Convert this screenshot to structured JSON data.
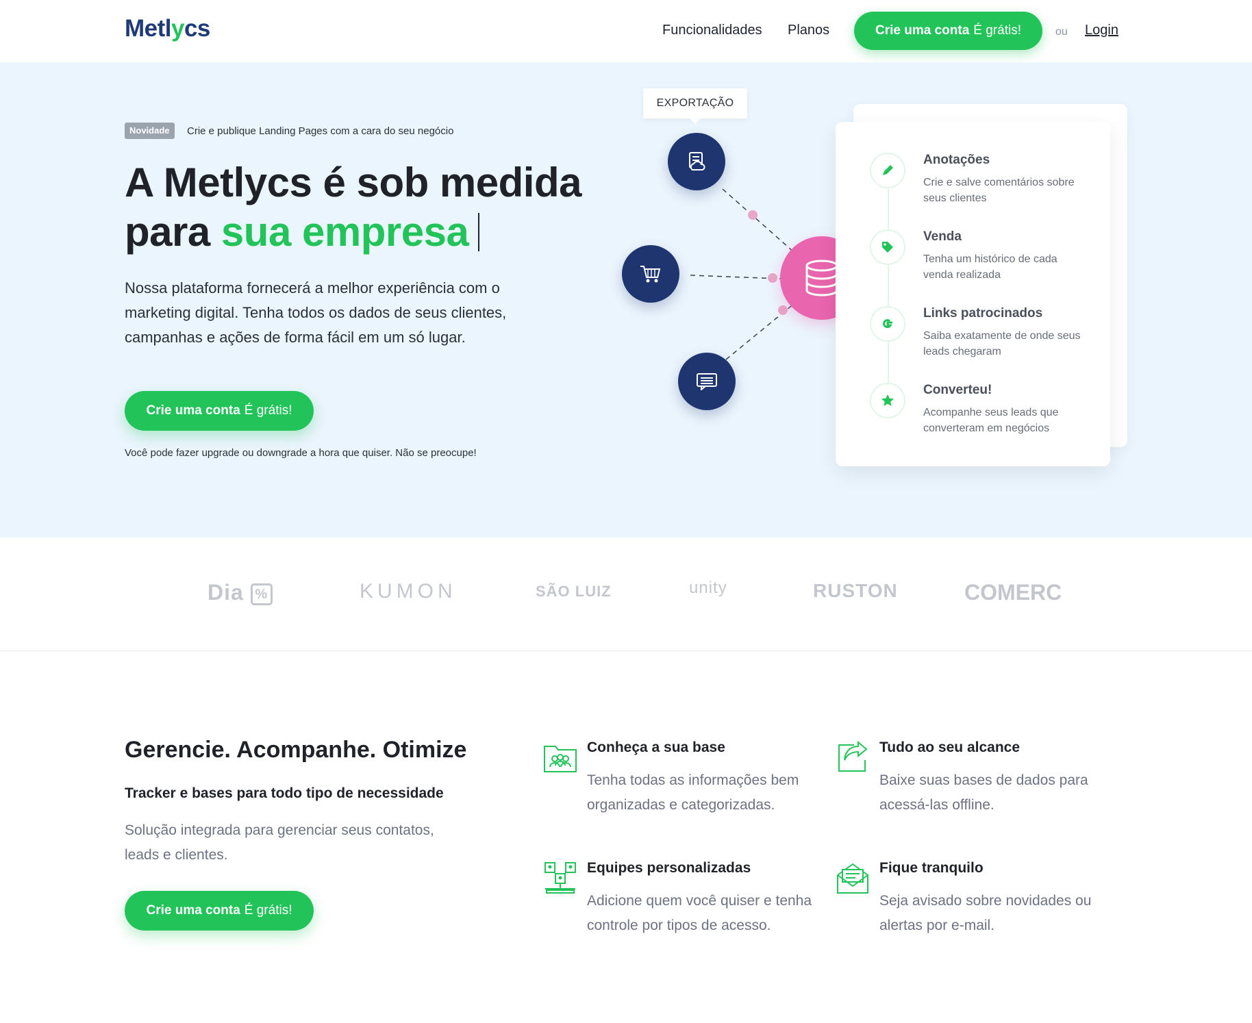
{
  "header": {
    "logo": "Metlycs",
    "nav": [
      "Funcionalidades",
      "Planos"
    ],
    "cta_bold": "Crie uma conta",
    "cta_light": "É grátis!",
    "or": "ou",
    "login": "Login"
  },
  "hero": {
    "badge": "Novidade",
    "badge_text": "Crie e publique Landing Pages com a cara do seu negócio",
    "title_line1": "A Metlycs é sob medida",
    "title_line2_prefix": "para ",
    "title_line2_highlight": "sua empresa",
    "description": "Nossa plataforma fornecerá a melhor experiência com o marketing digital. Tenha todos os dados de seus clientes, campanhas e ações de forma fácil em um só lugar.",
    "cta_bold": "Crie uma conta",
    "cta_light": "É grátis!",
    "note": "Você pode fazer upgrade ou downgrade a hora que quiser. Não se preocupe!",
    "tooltip": "EXPORTAÇÃO",
    "timeline": [
      {
        "title": "Anotações",
        "desc": "Crie e salve comentários sobre seus clientes",
        "icon": "pencil-icon"
      },
      {
        "title": "Venda",
        "desc": "Tenha um histórico de cada venda realizada",
        "icon": "tag-icon"
      },
      {
        "title": "Links patrocinados",
        "desc": "Saiba exatamente de onde seus leads chegaram",
        "icon": "google-icon"
      },
      {
        "title": "Converteu!",
        "desc": "Acompanhe seus leads que converteram em negócios",
        "icon": "star-icon"
      }
    ]
  },
  "logos": [
    "Dia",
    "KUMON",
    "SÃO LUIZ",
    "unity",
    "RUSTON",
    "COMERC"
  ],
  "features": {
    "title": "Gerencie. Acompanhe. Otimize",
    "subtitle": "Tracker e bases para todo tipo de necessidade",
    "description": "Solução integrada para gerenciar seus contatos, leads e clientes.",
    "cta_bold": "Crie uma conta",
    "cta_light": "É grátis!",
    "items": [
      {
        "title": "Conheça a sua base",
        "desc": "Tenha todas as informações bem organizadas e categorizadas.",
        "icon": "folder-users-icon"
      },
      {
        "title": "Tudo ao seu alcance",
        "desc": "Baixe suas bases de dados para acessá-las offline.",
        "icon": "share-icon"
      },
      {
        "title": "Equipes personalizadas",
        "desc": "Adicione quem você quiser e tenha controle por tipos de acesso.",
        "icon": "team-icon"
      },
      {
        "title": "Fique tranquilo",
        "desc": "Seja avisado sobre novidades ou alertas por e-mail.",
        "icon": "mail-icon"
      }
    ]
  },
  "colors": {
    "green": "#22c45a",
    "navy": "#1e3570",
    "pink": "#e965ae",
    "hero_bg": "#ebf5fd"
  }
}
